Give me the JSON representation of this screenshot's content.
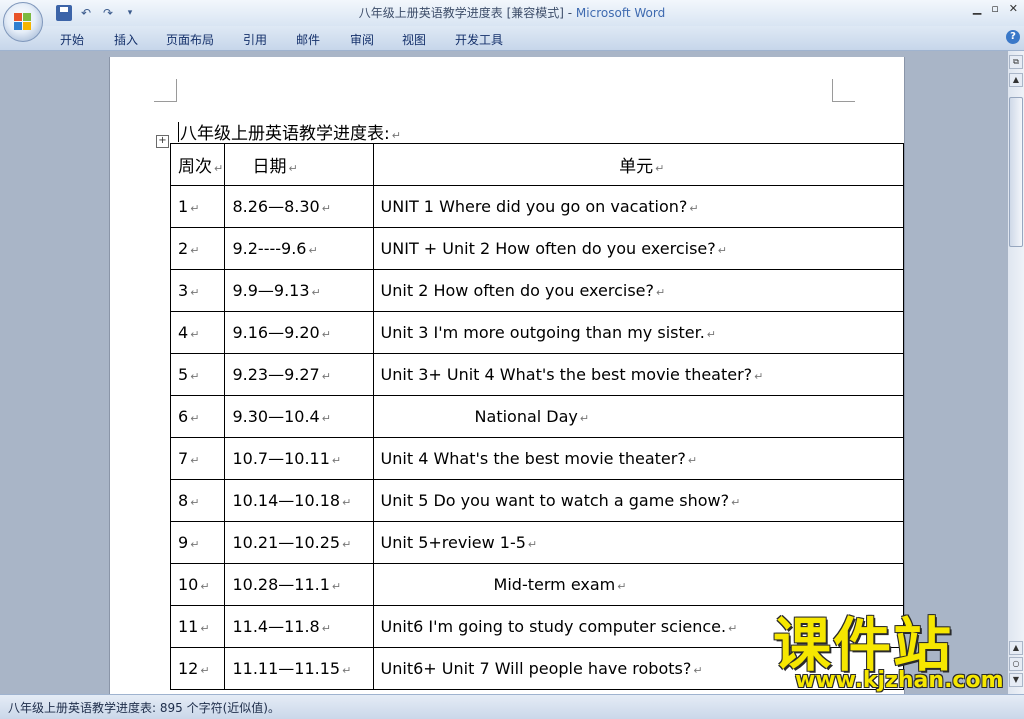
{
  "window": {
    "title_doc": "八年级上册英语教学进度表 [兼容模式] - ",
    "title_app": "Microsoft Word"
  },
  "ribbon": {
    "tabs": [
      "开始",
      "插入",
      "页面布局",
      "引用",
      "邮件",
      "审阅",
      "视图",
      "开发工具"
    ]
  },
  "document": {
    "heading": "八年级上册英语教学进度表:",
    "table": {
      "headers": [
        "周次",
        "日期",
        "单元"
      ],
      "rows": [
        [
          "1",
          "8.26—8.30",
          "UNIT 1 Where did you go on vacation?"
        ],
        [
          "2",
          "9.2----9.6",
          "UNIT + Unit 2 How often do you exercise?"
        ],
        [
          "3",
          "9.9—9.13",
          "Unit 2 How often do you exercise?"
        ],
        [
          "4",
          "9.16—9.20",
          "Unit 3 I'm more outgoing than my sister."
        ],
        [
          "5",
          "9.23—9.27",
          "Unit 3+ Unit 4 What's the best movie theater?"
        ],
        [
          "6",
          "9.30—10.4",
          "National Day"
        ],
        [
          "7",
          "10.7—10.11",
          "Unit 4 What's the best movie theater?"
        ],
        [
          "8",
          "10.14—10.18",
          "Unit 5 Do you want to watch a game show?"
        ],
        [
          "9",
          "10.21—10.25",
          "Unit 5+review 1-5"
        ],
        [
          "10",
          "10.28—11.1",
          "Mid-term exam"
        ],
        [
          "11",
          "11.4—11.8",
          "Unit6 I'm going to study computer science."
        ],
        [
          "12",
          "11.11—11.15",
          "Unit6+ Unit 7 Will people have robots?"
        ]
      ]
    }
  },
  "status": {
    "text": "八年级上册英语教学进度表: 895 个字符(近似值)。"
  },
  "watermark": {
    "cn": "课件站",
    "url": "www.kjzhan.com"
  },
  "icons": {
    "office_button": "office-logo-icon",
    "save": "save-icon",
    "undo": "undo-icon",
    "redo": "redo-icon",
    "help": "help-icon"
  },
  "colors": {
    "watermark": "#f6e700",
    "title_app": "#3e6ab0"
  }
}
